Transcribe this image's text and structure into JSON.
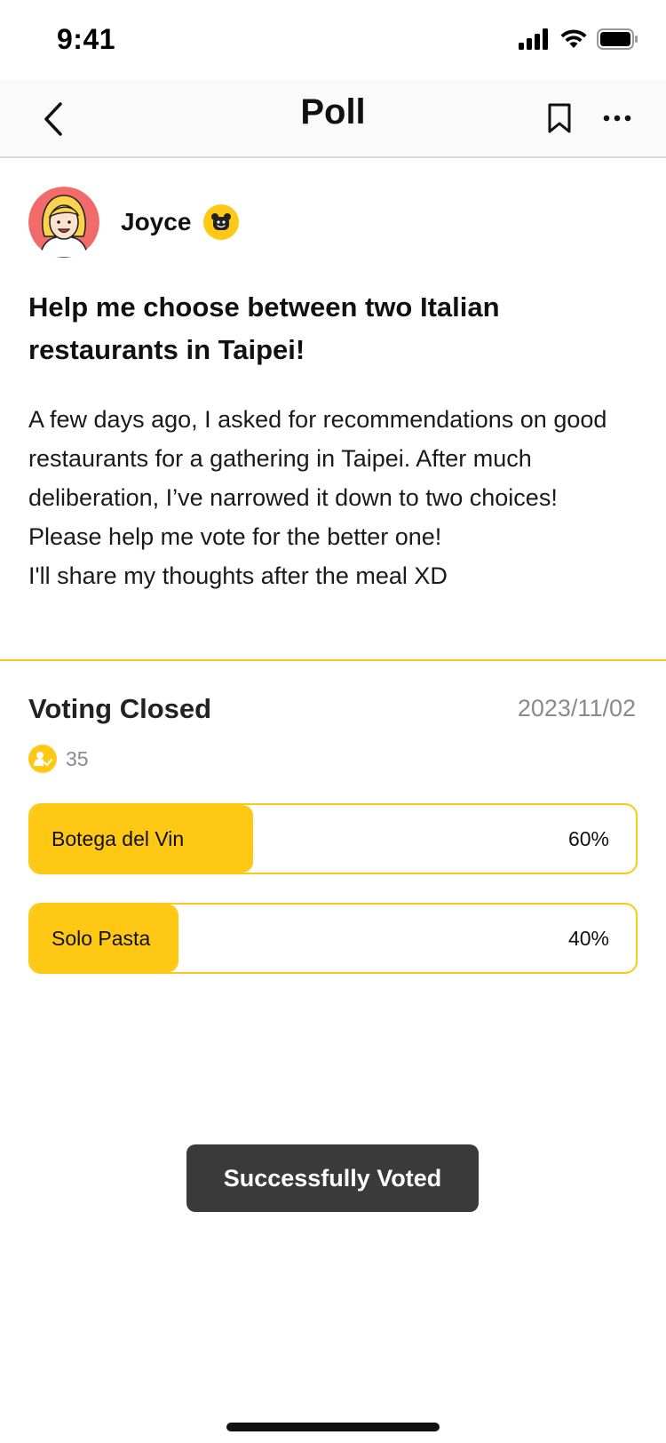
{
  "status_bar": {
    "time": "9:41"
  },
  "nav": {
    "title": "Poll"
  },
  "author": {
    "name": "Joyce"
  },
  "post": {
    "title": "Help me choose between two Italian restaurants in Taipei!",
    "body": [
      "A few days ago, I asked for recommendations on good restaurants for a gathering in Taipei. After much deliberation, I’ve narrowed it down to two choices!",
      "Please help me vote for the better one!",
      "I'll share my thoughts after the meal XD"
    ]
  },
  "poll": {
    "status": "Voting Closed",
    "date": "2023/11/02",
    "voter_count": "35",
    "options": [
      {
        "label": "Botega del Vin",
        "percent_text": "60%",
        "percent": 60
      },
      {
        "label": "Solo Pasta",
        "percent_text": "40%",
        "percent": 40
      }
    ]
  },
  "toast": {
    "message": "Successfully Voted"
  },
  "colors": {
    "accent": "#fec814",
    "toast_bg": "#3a3a3a",
    "muted_text": "#8a8a8a"
  },
  "icons": [
    "signal-icon",
    "wifi-icon",
    "battery-icon",
    "back-chevron-icon",
    "bookmark-icon",
    "more-dots-icon",
    "user-avatar",
    "bear-badge-icon",
    "voter-check-icon"
  ]
}
